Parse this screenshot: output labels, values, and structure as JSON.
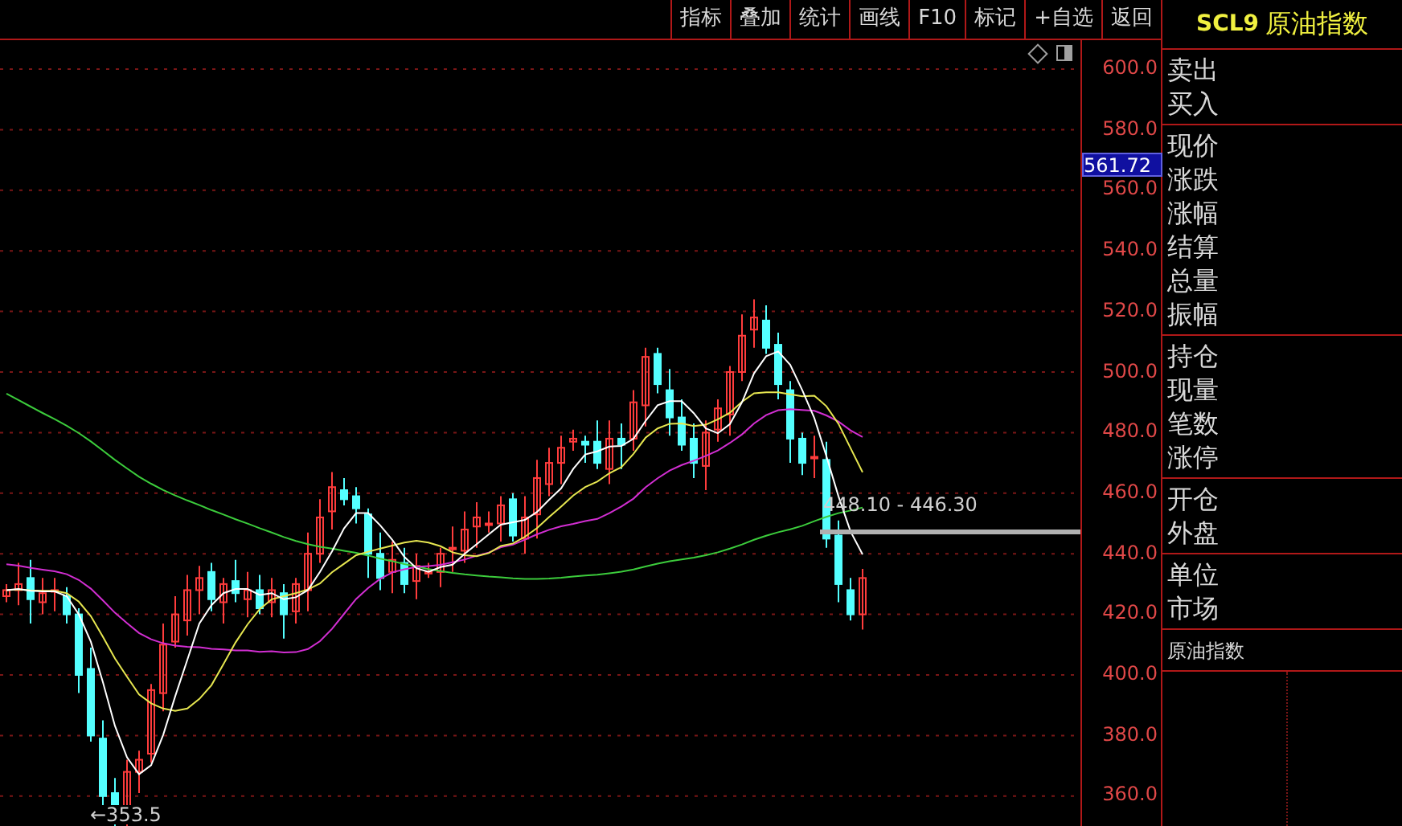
{
  "toolbar": [
    {
      "label": "指标"
    },
    {
      "label": "叠加"
    },
    {
      "label": "统计"
    },
    {
      "label": "画线"
    },
    {
      "label": "F10"
    },
    {
      "label": "标记"
    },
    {
      "label": "+自选"
    },
    {
      "label": "返回"
    }
  ],
  "panel_title": {
    "code": "SCL9",
    "name": "原油指数"
  },
  "price_axis": [
    "600.0",
    "580.0",
    "560.0",
    "540.0",
    "520.0",
    "500.0",
    "480.0",
    "460.0",
    "440.0",
    "420.0",
    "400.0",
    "380.0",
    "360.0"
  ],
  "current_price": "561.72",
  "range_label": "448.10 - 446.30",
  "low_label": "←353.5",
  "quote_groups": [
    [
      "卖出",
      "买入"
    ],
    [
      "现价",
      "涨跌",
      "涨幅",
      "结算",
      "总量",
      "振幅"
    ],
    [
      "持仓",
      "现量",
      "笔数",
      "涨停"
    ],
    [
      "开仓",
      "外盘"
    ],
    [
      "单位",
      "市场"
    ]
  ],
  "instrument_name": "原油指数"
}
